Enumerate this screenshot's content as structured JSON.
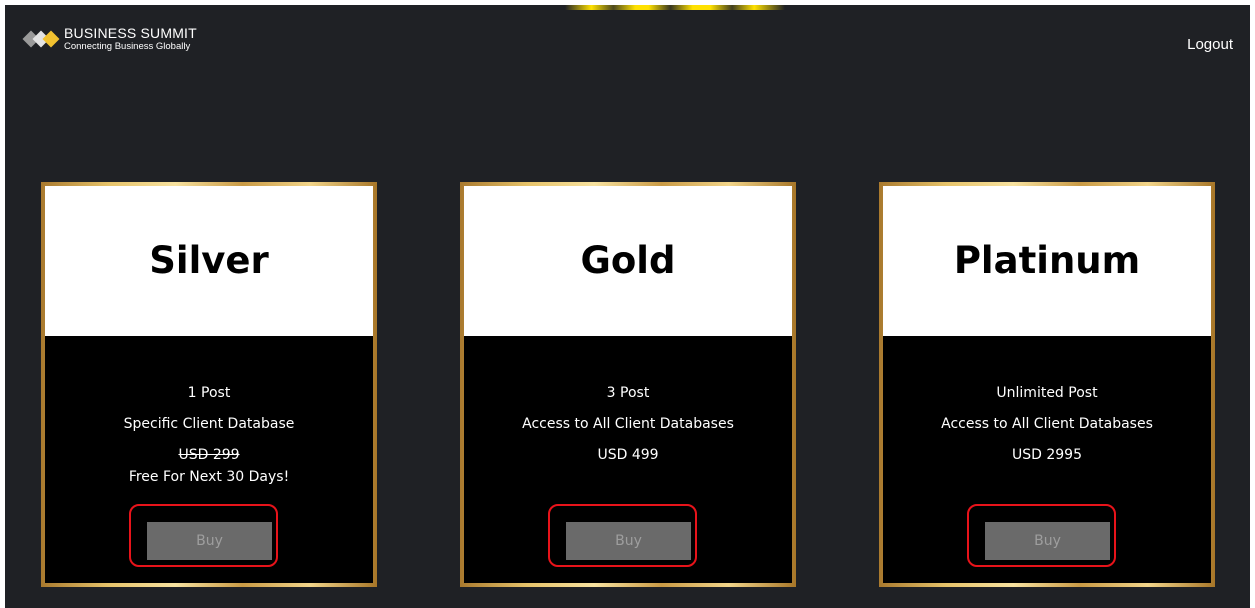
{
  "header": {
    "brand_name": "BUSINESS SUMMIT",
    "brand_tagline": "Connecting Business Globally",
    "logout_label": "Logout",
    "logo_icon": "diamond-chevron-logo-icon",
    "logo_colors": [
      "#f2c230",
      "#e3e3e3",
      "#9a9a9a"
    ]
  },
  "colors": {
    "page_background": "#1f2125",
    "card_border_gold": "#e6c36a",
    "highlight_ring": "#e8131a",
    "buy_button": "#6a6a6a"
  },
  "plans": [
    {
      "name": "Silver",
      "lines": [
        "1 Post",
        "Specific Client Database"
      ],
      "original_price": "USD 299",
      "promo": "Free For Next 30 Days!",
      "buy_label": "Buy"
    },
    {
      "name": "Gold",
      "lines": [
        "3 Post",
        "Access to All Client Databases"
      ],
      "price": "USD 499",
      "buy_label": "Buy"
    },
    {
      "name": "Platinum",
      "lines": [
        "Unlimited Post",
        "Access to All Client Databases"
      ],
      "price": "USD 2995",
      "buy_label": "Buy"
    }
  ]
}
